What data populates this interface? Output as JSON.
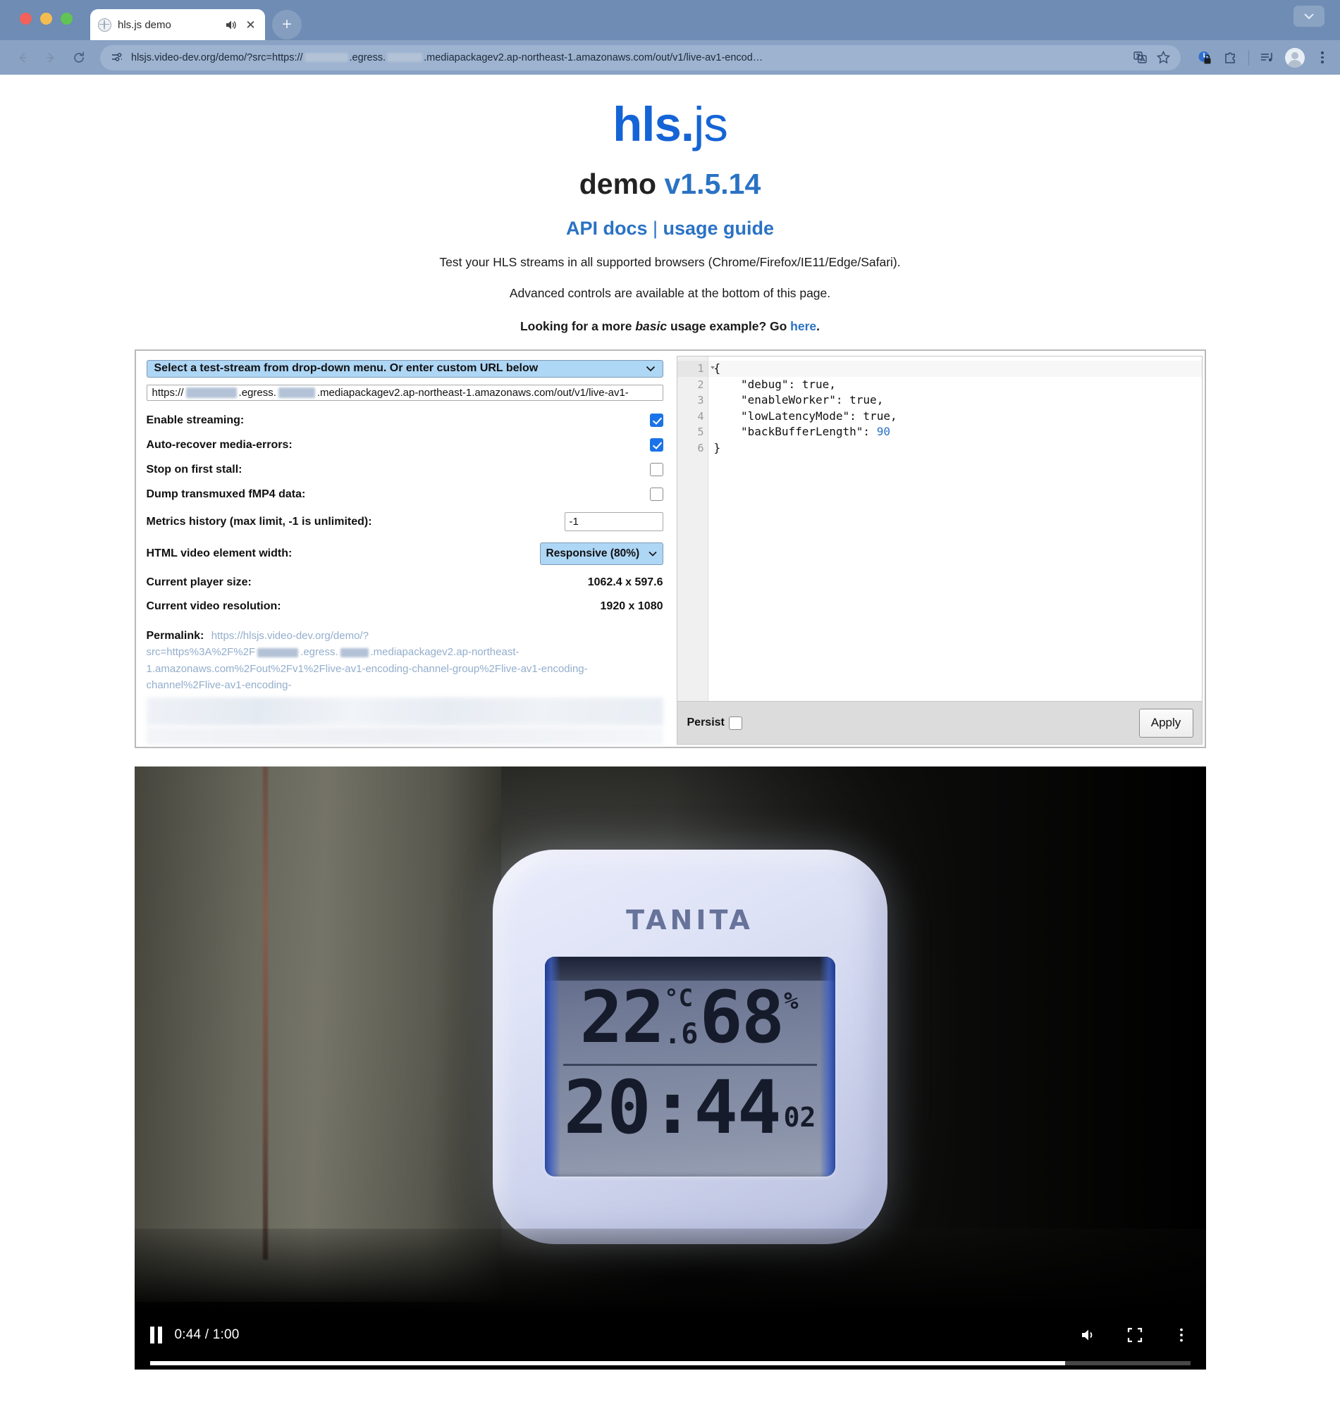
{
  "browser": {
    "tab": {
      "title": "hls.js demo",
      "favicon_icon": "globe-icon",
      "audio_icon": "speaker-icon",
      "close_icon": "close-icon"
    },
    "new_tab_label": "+",
    "omnibox": {
      "site_icon": "page-settings-icon",
      "url_prefix": "hlsjs.video-dev.org/demo/?src=https://",
      "url_mid": ".egress.",
      "url_suffix": ".mediapackagev2.ap-northeast-1.amazonaws.com/out/v1/live-av1-encod…",
      "translate_icon": "translate-icon",
      "bookmark_icon": "star-icon"
    },
    "toolbar_icons": [
      "privacy-shield-icon",
      "extensions-icon",
      "media-playlist-icon",
      "profile-avatar-icon",
      "chrome-menu-icon"
    ],
    "back_icon": "back-arrow-icon",
    "forward_icon": "forward-arrow-icon",
    "reload_icon": "reload-icon",
    "expand_icon": "chevron-down-icon"
  },
  "page": {
    "logo": {
      "main": "hls",
      "dot": ".",
      "suffix": "js"
    },
    "demo_title": "demo ",
    "version": "v1.5.14",
    "links": {
      "api_docs": "API docs",
      "separator": " | ",
      "usage_guide": "usage guide"
    },
    "lead1": "Test your HLS streams in all supported browsers (Chrome/Firefox/IE11/Edge/Safari).",
    "lead2": "Advanced controls are available at the bottom of this page.",
    "lead3_pre": "Looking for a more ",
    "lead3_em": "basic",
    "lead3_mid": " usage example? Go ",
    "lead3_link": "here",
    "lead3_end": "."
  },
  "controls": {
    "stream_select_label": "Select a test-stream from drop-down menu. Or enter custom URL below",
    "url_value_prefix": "https://",
    "url_value_mid": ".egress.",
    "url_value_suffix": ".mediapackagev2.ap-northeast-1.amazonaws.com/out/v1/live-av1-",
    "rows": [
      {
        "label": "Enable streaming:",
        "checked": true
      },
      {
        "label": "Auto-recover media-errors:",
        "checked": true
      },
      {
        "label": "Stop on first stall:",
        "checked": false
      },
      {
        "label": "Dump transmuxed fMP4 data:",
        "checked": false
      }
    ],
    "metrics_label": "Metrics history (max limit, -1 is unlimited):",
    "metrics_value": "-1",
    "width_label": "HTML video element width:",
    "width_value": "Responsive (80%)",
    "player_size_label": "Current player size:",
    "player_size_value": "1062.4 x 597.6",
    "resolution_label": "Current video resolution:",
    "resolution_value": "1920 x 1080",
    "permalink_label": "Permalink:",
    "permalink_part1": "https://hlsjs.video-dev.org/demo/?",
    "permalink_part2": "src=https%3A%2F%2F",
    "permalink_part3": ".egress.",
    "permalink_part4": ".mediapackagev2.ap-northeast-",
    "permalink_part5": "1.amazonaws.com%2Fout%2Fv1%2Flive-av1-encoding-channel-group%2Flive-av1-encoding-",
    "permalink_part6": "channel%2Flive-av1-encoding-"
  },
  "editor": {
    "line_numbers": [
      "1",
      "2",
      "3",
      "4",
      "5",
      "6"
    ],
    "lines": [
      "{",
      "    \"debug\": true,",
      "    \"enableWorker\": true,",
      "    \"lowLatencyMode\": true,",
      "    \"backBufferLength\": ",
      "}"
    ],
    "back_buffer_value": "90",
    "persist_label": "Persist",
    "persist_checked": false,
    "apply_label": "Apply"
  },
  "video": {
    "play_state_icon": "pause-icon",
    "time_display": "0:44 / 1:00",
    "volume_icon": "volume-icon",
    "fullscreen_icon": "fullscreen-icon",
    "more_icon": "more-vertical-icon",
    "progress_percent": 88,
    "scene": {
      "device_brand": "TANITA",
      "temperature": "22",
      "temperature_decimal": ".6",
      "temperature_unit": "°C",
      "humidity": "68",
      "humidity_unit": "%",
      "clock": "20:44",
      "seconds": "02"
    }
  },
  "colors": {
    "accent_blue": "#1464d6",
    "link_blue": "#2a72c4",
    "chrome_bar": "#8aa2c3",
    "select_blue": "#aed6f5",
    "checkbox_on": "#1a73e8"
  }
}
